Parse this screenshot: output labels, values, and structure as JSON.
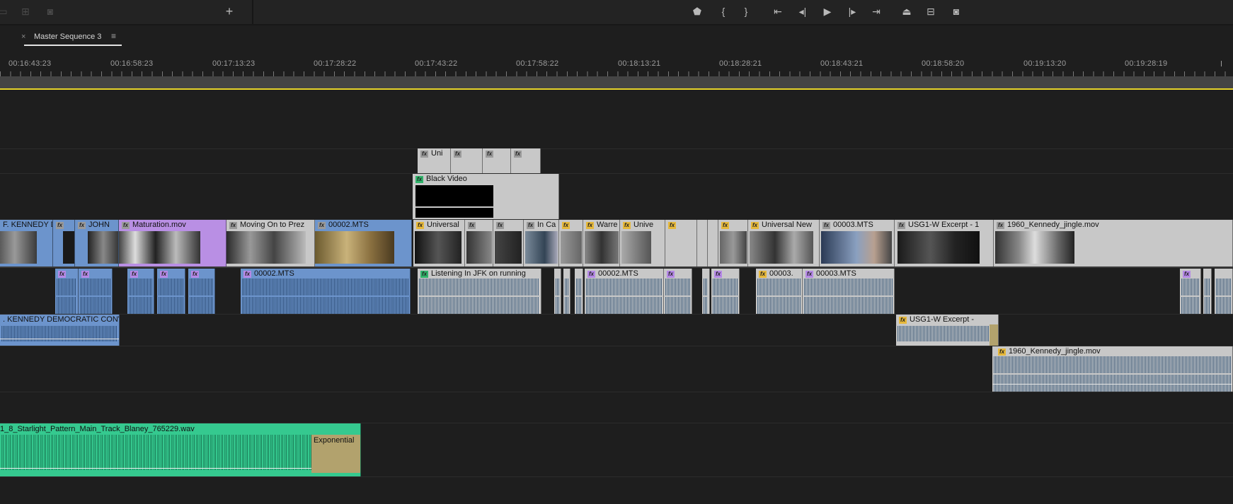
{
  "toolbar": {
    "left_icons": [
      "linked-selection-icon",
      "insert-icon",
      "camera-icon"
    ],
    "add_label": "+",
    "playback_icons": [
      "marker-icon",
      "mark-in-icon",
      "mark-out-icon",
      "go-to-in-icon",
      "step-back-icon",
      "play-icon",
      "step-forward-icon",
      "go-to-out-icon",
      "lift-icon",
      "extract-icon",
      "export-frame-icon"
    ]
  },
  "sequence_tab": {
    "close": "×",
    "name": "Master Sequence 3",
    "menu": "≡"
  },
  "ruler": {
    "timecodes": [
      "00:16:43:23",
      "00:16:58:23",
      "00:17:13:23",
      "00:17:28:22",
      "00:17:43:22",
      "00:17:58:22",
      "00:18:13:21",
      "00:18:28:21",
      "00:18:43:21",
      "00:18:58:20",
      "00:19:13:20",
      "00:19:28:19"
    ]
  },
  "tracks": {
    "v3": [
      {
        "label": "Uni",
        "fx": "n"
      },
      {
        "label": "",
        "fx": "n"
      },
      {
        "label": "",
        "fx": "n"
      },
      {
        "label": "",
        "fx": "n"
      }
    ],
    "v2": [
      {
        "label": "Black Video",
        "fx": "g"
      }
    ],
    "v1": [
      {
        "label": "F. KENNEDY D",
        "fx": ""
      },
      {
        "label": "",
        "fx": "n"
      },
      {
        "label": "JOHN",
        "fx": "n"
      },
      {
        "label": "Maturation.mov",
        "fx": "n"
      },
      {
        "label": "Moving On to Prez",
        "fx": "n"
      },
      {
        "label": "00002.MTS",
        "fx": "n"
      },
      {
        "label": "Universal",
        "fx": "y"
      },
      {
        "label": "",
        "fx": "n"
      },
      {
        "label": "",
        "fx": "n"
      },
      {
        "label": "In Ca",
        "fx": "n"
      },
      {
        "label": "",
        "fx": "y"
      },
      {
        "label": "Warre",
        "fx": "y"
      },
      {
        "label": "Unive",
        "fx": "y"
      },
      {
        "label": "",
        "fx": "y"
      },
      {
        "label": "",
        "fx": "y"
      },
      {
        "label": "Universal New",
        "fx": "y"
      },
      {
        "label": "00003.MTS",
        "fx": "n"
      },
      {
        "label": "USG1-W Excerpt - 1",
        "fx": "n"
      },
      {
        "label": "1960_Kennedy_jingle.mov",
        "fx": "n"
      }
    ],
    "a1": [
      {
        "label": "",
        "fx": "p"
      },
      {
        "label": "",
        "fx": "p"
      },
      {
        "label": "",
        "fx": "p"
      },
      {
        "label": "",
        "fx": "p"
      },
      {
        "label": "",
        "fx": "p"
      },
      {
        "label": "00002.MTS",
        "fx": "p"
      },
      {
        "label": "Listening In JFK on running",
        "fx": "g"
      },
      {
        "label": "00002.MTS",
        "fx": "p"
      },
      {
        "label": "",
        "fx": "p"
      },
      {
        "label": "",
        "fx": "p"
      },
      {
        "label": "00003.",
        "fx": "y"
      },
      {
        "label": "00003.MTS",
        "fx": "p"
      },
      {
        "label": "",
        "fx": "p"
      }
    ],
    "a2": [
      {
        "label": ". KENNEDY DEMOCRATIC CONV",
        "fx": ""
      },
      {
        "label": "USG1-W Excerpt -",
        "fx": "y"
      }
    ],
    "a3": [
      {
        "label": "1960_Kennedy_jingle.mov",
        "fx": "y"
      }
    ],
    "a4": [
      {
        "label": "1_8_Starlight_Pattern_Main_Track_Blaney_765229.wav",
        "fx": ""
      },
      {
        "label": "Exponential",
        "fx": ""
      }
    ]
  },
  "colors": {
    "video_blue": "#6c94cc",
    "clip_gray": "#c8c8c8",
    "clip_purple": "#b98fe4",
    "music_green": "#35c98f",
    "work_area": "#e6d42a"
  }
}
